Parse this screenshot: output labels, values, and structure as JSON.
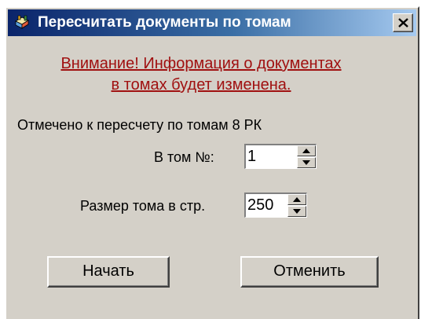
{
  "window": {
    "title": "Пересчитать документы по томам",
    "close_icon": "close-icon",
    "app_icon": "books-icon"
  },
  "warning": {
    "line1": "Внимание! Информация о документах",
    "line2": "в томах будет изменена."
  },
  "status": {
    "text": "Отмечено к пересчету по томам 8 РК"
  },
  "fields": {
    "volume_number": {
      "label": "В том №:",
      "value": "1"
    },
    "volume_size": {
      "label": "Размер тома в стр.",
      "value": "250"
    }
  },
  "buttons": {
    "start_label": "Начать",
    "cancel_label": "Отменить"
  },
  "colors": {
    "title_bar": "#0a246a",
    "warning_text": "#a01010",
    "dialog_face": "#d4d0c8"
  }
}
